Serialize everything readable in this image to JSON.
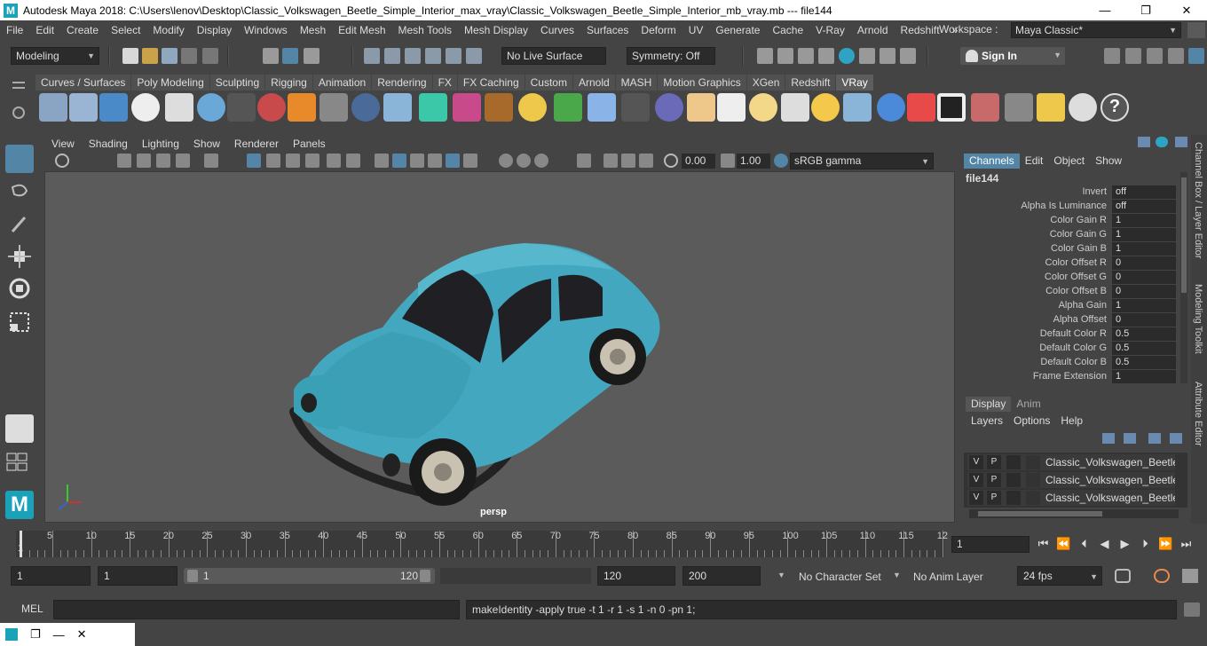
{
  "window": {
    "title": "Autodesk Maya 2018: C:\\Users\\lenov\\Desktop\\Classic_Volkswagen_Beetle_Simple_Interior_max_vray\\Classic_Volkswagen_Beetle_Simple_Interior_mb_vray.mb   ---   file144",
    "logo": "M",
    "minimize": "—",
    "maximize": "❐",
    "close": "✕"
  },
  "menubar": {
    "items": [
      "File",
      "Edit",
      "Create",
      "Select",
      "Modify",
      "Display",
      "Windows",
      "Mesh",
      "Edit Mesh",
      "Mesh Tools",
      "Mesh Display",
      "Curves",
      "Surfaces",
      "Deform",
      "UV",
      "Generate",
      "Cache",
      "V-Ray",
      "Arnold",
      "Redshift"
    ],
    "more": "»",
    "workspace_label": "Workspace :",
    "workspace_value": "Maya Classic*"
  },
  "statusline": {
    "mode": "Modeling",
    "live_surface": "No Live Surface",
    "symmetry": "Symmetry: Off",
    "sign_in": "Sign In"
  },
  "shelf": {
    "tabs": [
      "Curves / Surfaces",
      "Poly Modeling",
      "Sculpting",
      "Rigging",
      "Animation",
      "Rendering",
      "FX",
      "FX Caching",
      "Custom",
      "Arnold",
      "MASH",
      "Motion Graphics",
      "XGen",
      "Redshift",
      "VRay"
    ],
    "active_tab": "VRay",
    "help_glyph": "?"
  },
  "viewport": {
    "menu": [
      "View",
      "Shading",
      "Lighting",
      "Show",
      "Renderer",
      "Panels"
    ],
    "exposure": "0.00",
    "gamma": "1.00",
    "color_space": "sRGB gamma",
    "camera_label": "persp"
  },
  "channelbox": {
    "tabs": [
      "Channels",
      "Edit",
      "Object",
      "Show"
    ],
    "node": "file144",
    "attributes": [
      {
        "name": "Invert",
        "value": "off"
      },
      {
        "name": "Alpha Is Luminance",
        "value": "off"
      },
      {
        "name": "Color Gain R",
        "value": "1"
      },
      {
        "name": "Color Gain G",
        "value": "1"
      },
      {
        "name": "Color Gain B",
        "value": "1"
      },
      {
        "name": "Color Offset R",
        "value": "0"
      },
      {
        "name": "Color Offset G",
        "value": "0"
      },
      {
        "name": "Color Offset B",
        "value": "0"
      },
      {
        "name": "Alpha Gain",
        "value": "1"
      },
      {
        "name": "Alpha Offset",
        "value": "0"
      },
      {
        "name": "Default Color R",
        "value": "0.5"
      },
      {
        "name": "Default Color G",
        "value": "0.5"
      },
      {
        "name": "Default Color B",
        "value": "0.5"
      },
      {
        "name": "Frame Extension",
        "value": "1"
      }
    ]
  },
  "layers": {
    "tabs": [
      "Display",
      "Anim"
    ],
    "menu": [
      "Layers",
      "Options",
      "Help"
    ],
    "rows": [
      {
        "v": "V",
        "p": "P",
        "name": "Classic_Volkswagen_Beetle_S"
      },
      {
        "v": "V",
        "p": "P",
        "name": "Classic_Volkswagen_Beetle_S"
      },
      {
        "v": "V",
        "p": "P",
        "name": "Classic_Volkswagen_Beetle_S"
      }
    ]
  },
  "side_tabs": [
    "Channel Box / Layer Editor",
    "Modeling Toolkit",
    "Attribute Editor"
  ],
  "timeline": {
    "ticks": [
      "5",
      "10",
      "15",
      "20",
      "25",
      "30",
      "35",
      "40",
      "45",
      "50",
      "55",
      "60",
      "65",
      "70",
      "75",
      "80",
      "85",
      "90",
      "95",
      "100",
      "105",
      "110",
      "115",
      "12"
    ],
    "start_marker": "1",
    "current_frame": "1",
    "playback": [
      "⏮",
      "⏪",
      "⏴",
      "◀",
      "▶",
      "⏵",
      "⏩",
      "⏭"
    ]
  },
  "range": {
    "start": "1",
    "playback_start": "1",
    "slider_min": "1",
    "slider_max": "120",
    "playback_end": "120",
    "end": "200",
    "character_set": "No Character Set",
    "anim_layer": "No Anim Layer",
    "fps": "24 fps"
  },
  "command": {
    "label": "MEL",
    "output": "makeIdentity -apply true -t 1 -r 1 -s 1 -n 0 -pn 1;"
  },
  "colors": {
    "car_body": "#43a8bf",
    "accent": "#5285a6",
    "panel": "#444444"
  }
}
